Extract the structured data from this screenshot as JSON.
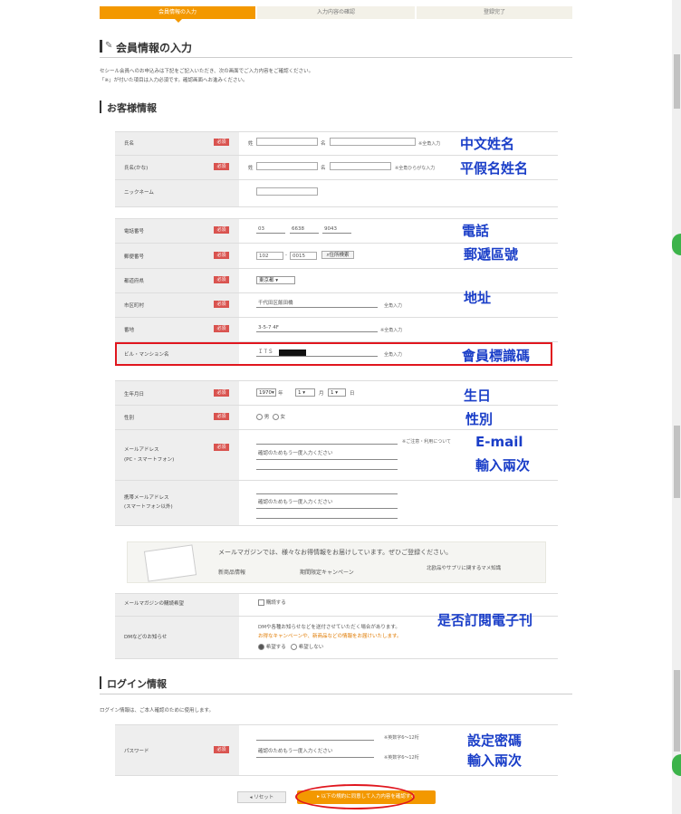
{
  "steps": [
    "会員情報の入力",
    "入力内容の確認",
    "登録完了"
  ],
  "page_title": "会員情報の入力",
  "intro": [
    "セシール会員へのお申込みは下記をご記入いただき、次の画面でご入力内容をご確認ください。",
    "「※」が付いた項目は入力必須です。確認画面へお進みください。"
  ],
  "section_customer": "お客様情報",
  "rows": {
    "name": {
      "label": "氏名",
      "req": "必須",
      "sei": "姓",
      "mei": "名",
      "note": "※全角入力"
    },
    "kana": {
      "label": "氏名(かな)",
      "req": "必須",
      "sei": "姓",
      "mei": "名",
      "note": "※全角ひらがな入力"
    },
    "nickname": {
      "label": "ニックネーム"
    },
    "phone": {
      "label": "電話番号",
      "req": "必須",
      "v1": "03",
      "v2": "6638",
      "v3": "9043"
    },
    "zip": {
      "label": "郵便番号",
      "req": "必須",
      "v1": "102",
      "v2": "0015",
      "btn": "住所検索"
    },
    "pref": {
      "label": "都道府県",
      "req": "必須",
      "value": "東京都"
    },
    "city": {
      "label": "市区町村",
      "req": "必須",
      "value": "千代田区飯田橋",
      "note": "全角入力"
    },
    "banchi": {
      "label": "番地",
      "req": "必須",
      "value": "3-5-7 4F",
      "note": "※全角入力"
    },
    "building": {
      "label": "ビル・マンション名",
      "value": "ＩＴＳ",
      "note": "全角入力"
    },
    "birth": {
      "label": "生年月日",
      "req": "必須",
      "year": "1970",
      "month": "1",
      "day": "1",
      "y": "年",
      "m": "月",
      "d": "日"
    },
    "gender": {
      "label": "性別",
      "req": "必須",
      "male": "男",
      "female": "女"
    },
    "email": {
      "label": "メールアドレス",
      "label2": "(PC・スマートフォン)",
      "req": "必須",
      "note": "※ご注意・利用について",
      "confirm": "確認のためもう一度入力ください"
    },
    "mobile": {
      "label": "携帯メールアドレス",
      "label2": "(スマートフォン以外)",
      "confirm": "確認のためもう一度入力ください"
    }
  },
  "banner": {
    "line1": "メールマガジンでは、様々なお得情報をお届けしています。ぜひご登録ください。",
    "items": [
      "新商品情報",
      "期間限定キャンペーン",
      "北欧品やサプリに関するマメ知識"
    ]
  },
  "mailmag": {
    "label": "メールマガジンの購読希望",
    "option": "購読する"
  },
  "dm": {
    "label": "DMなどのお知らせ",
    "text1": "DMや各種お知らせなどを送付させていただく場合があります。",
    "text2": "お得なキャンペーンや、新商品などの情報をお届けいたします。",
    "yes": "希望する",
    "no": "希望しない"
  },
  "section_login": "ログイン情報",
  "login_intro": "ログイン情報は、ご本人確認のために使用します。",
  "password": {
    "label": "パスワード",
    "req": "必須",
    "confirm": "確認のためもう一度入力ください",
    "note1": "※英数字6〜12桁",
    "note2": "※英数字6〜12桁"
  },
  "buttons": {
    "reset": "リセット",
    "submit": "以下の規約に同意して入力内容を確認する"
  },
  "annotations": {
    "name": "中文姓名",
    "kana": "平假名姓名",
    "phone": "電話",
    "zip": "郵遞區號",
    "address": "地址",
    "member_id": "會員標識碼",
    "birth": "生日",
    "gender": "性別",
    "email1": "E-mail",
    "email2": "輸入兩次",
    "mailmag": "是否訂閱電子刊",
    "pw1": "設定密碼",
    "pw2": "輸入兩次"
  },
  "colors": {
    "accent": "#f39800",
    "required": "#d9534f",
    "annotation": "#1a3ec8",
    "highlight": "#e0161e"
  }
}
